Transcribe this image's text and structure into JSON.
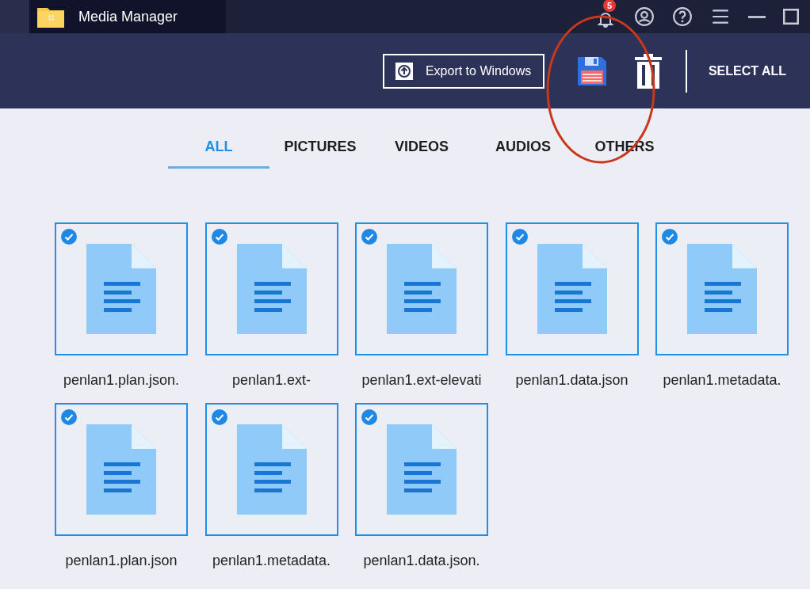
{
  "window": {
    "title": "Media Manager",
    "notification_count": "5"
  },
  "toolbar": {
    "export_button": "Export to Windows",
    "select_all": "SELECT ALL"
  },
  "tabs": [
    {
      "label": "ALL",
      "selected": true
    },
    {
      "label": "PICTURES",
      "selected": false
    },
    {
      "label": "VIDEOS",
      "selected": false
    },
    {
      "label": "AUDIOS",
      "selected": false
    },
    {
      "label": "OTHERS",
      "selected": false
    }
  ],
  "files": [
    {
      "name": "penlan1.plan.json.",
      "checked": true
    },
    {
      "name": "penlan1.ext-",
      "checked": true
    },
    {
      "name": "penlan1.ext-elevati",
      "checked": true
    },
    {
      "name": "penlan1.data.json",
      "checked": true
    },
    {
      "name": "penlan1.metadata.",
      "checked": true
    },
    {
      "name": "penlan1.plan.json",
      "checked": true
    },
    {
      "name": "penlan1.metadata.",
      "checked": true
    },
    {
      "name": "penlan1.data.json.",
      "checked": true
    }
  ],
  "annotations": [
    {
      "kind": "ellipse",
      "color": "#c8381c"
    }
  ]
}
